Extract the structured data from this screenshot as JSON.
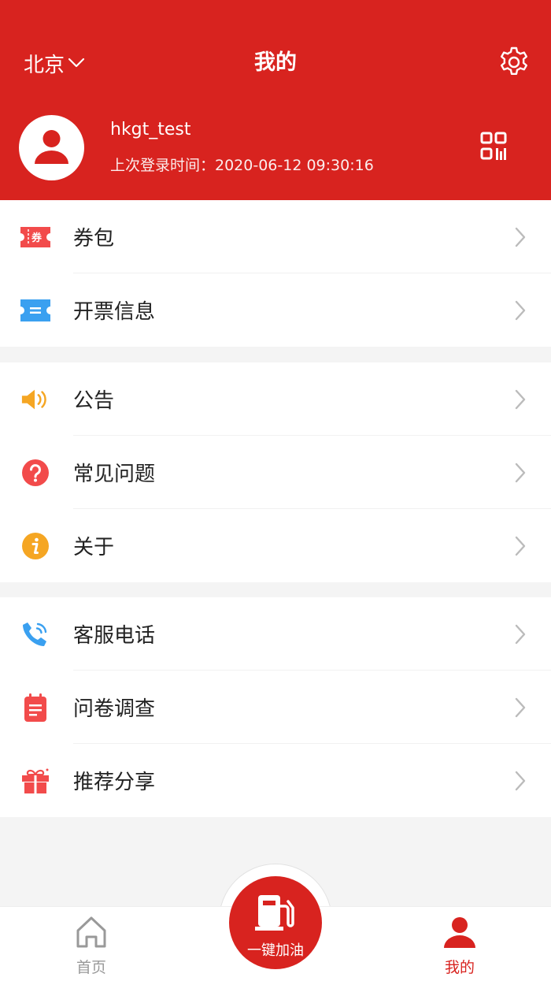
{
  "header": {
    "city": "北京",
    "title": "我的",
    "username": "hkgt_test",
    "last_login": "上次登录时间：2020-06-12 09:30:16"
  },
  "menu": {
    "group1": [
      {
        "label": "券包",
        "icon": "coupon-icon"
      },
      {
        "label": "开票信息",
        "icon": "invoice-icon"
      }
    ],
    "group2": [
      {
        "label": "公告",
        "icon": "speaker-icon"
      },
      {
        "label": "常见问题",
        "icon": "question-icon"
      },
      {
        "label": "关于",
        "icon": "info-icon"
      }
    ],
    "group3": [
      {
        "label": "客服电话",
        "icon": "phone-icon"
      },
      {
        "label": "问卷调查",
        "icon": "survey-icon"
      },
      {
        "label": "推荐分享",
        "icon": "gift-icon"
      }
    ]
  },
  "coupon_icon_text": "券",
  "tabbar": {
    "home": "首页",
    "center": "一键加油",
    "me": "我的"
  },
  "colors": {
    "brand": "#d8231f",
    "orange": "#f5a623",
    "blue": "#3aa0f0"
  }
}
